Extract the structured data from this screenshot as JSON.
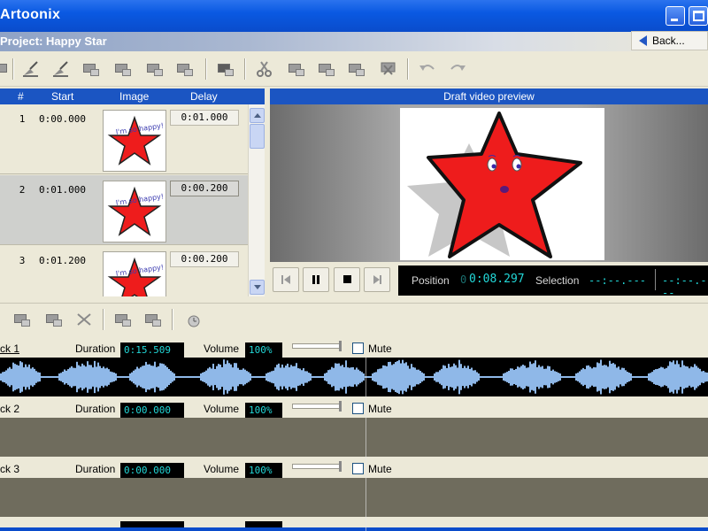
{
  "window": {
    "title": "Artoonix",
    "project_title": "Project: Happy Star",
    "back_label": "Back..."
  },
  "toolbar": {
    "icons": [
      "brush-icon",
      "brush-alt-icon",
      "add-frame-icon",
      "insert-frame-icon",
      "import-icon",
      "export-icon",
      "capture-icon",
      "cut-icon",
      "copy-icon",
      "paste-icon",
      "paste-special-icon",
      "delete-icon",
      "undo-icon",
      "redo-icon"
    ]
  },
  "frames": {
    "headers": {
      "num": "#",
      "start": "Start",
      "image": "Image",
      "delay": "Delay"
    },
    "rows": [
      {
        "num": "1",
        "start": "0:00.000",
        "delay": "0:01.000",
        "selected": false
      },
      {
        "num": "2",
        "start": "0:01.000",
        "delay": "0:00.200",
        "selected": true
      },
      {
        "num": "3",
        "start": "0:01.200",
        "delay": "0:00.200",
        "selected": false
      }
    ]
  },
  "preview": {
    "title": "Draft video preview",
    "position_label": "Position",
    "position_value": "0:08.297",
    "selection_label": "Selection",
    "selection_start": "--:--.---",
    "selection_end": "--:--.---"
  },
  "tracks": {
    "duration_label": "Duration",
    "volume_label": "Volume",
    "mute_label": "Mute",
    "items": [
      {
        "name": "ck 1",
        "duration": "0:15.509",
        "volume": "100%",
        "volume_level": 1.0,
        "underline": true,
        "has_audio": true
      },
      {
        "name": "ck 2",
        "duration": "0:00.000",
        "volume": "100%",
        "volume_level": 1.0,
        "underline": false,
        "has_audio": false
      },
      {
        "name": "ck 3",
        "duration": "0:00.000",
        "volume": "100%",
        "volume_level": 1.0,
        "underline": false,
        "has_audio": false
      }
    ]
  },
  "colors": {
    "titlebar": "#0a59e2",
    "panel_header": "#1b55c2",
    "lcd_text": "#22d8d8",
    "waveform": "#8fb8e8",
    "star_fill": "#ee1c1c"
  }
}
